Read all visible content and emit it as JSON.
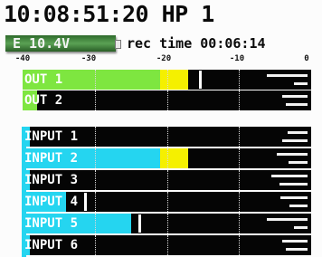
{
  "header": {
    "timecode": "10:08:51:20 HP 1",
    "battery_label": "E 10.4V",
    "rec_time": "rec time 00:06:14"
  },
  "scale": {
    "labels": [
      "-40",
      "-30",
      "-20",
      "-10",
      "0"
    ]
  },
  "colors": {
    "output_fill": "#7ee640",
    "input_fill": "#25d5f0",
    "warn": "#f5f000",
    "background": "#050505"
  },
  "outputs": [
    {
      "label": "OUT 1",
      "level_db": -21,
      "warn_db": -17,
      "peak_db": -15.5
    },
    {
      "label": "OUT 2",
      "level_db": -38,
      "warn_db": null,
      "peak_db": null
    }
  ],
  "inputs": [
    {
      "label": "INPUT 1",
      "level_db": -39,
      "warn_db": null,
      "peak_db": null
    },
    {
      "label": "INPUT 2",
      "level_db": -21,
      "warn_db": -17,
      "peak_db": null
    },
    {
      "label": "INPUT 3",
      "level_db": -39,
      "warn_db": null,
      "peak_db": null
    },
    {
      "label": "INPUT 4",
      "level_db": -34,
      "warn_db": null,
      "peak_db": -31.5
    },
    {
      "label": "INPUT 5",
      "level_db": -25,
      "warn_db": null,
      "peak_db": -24
    },
    {
      "label": "INPUT 6",
      "level_db": -39,
      "warn_db": null,
      "peak_db": null
    }
  ]
}
